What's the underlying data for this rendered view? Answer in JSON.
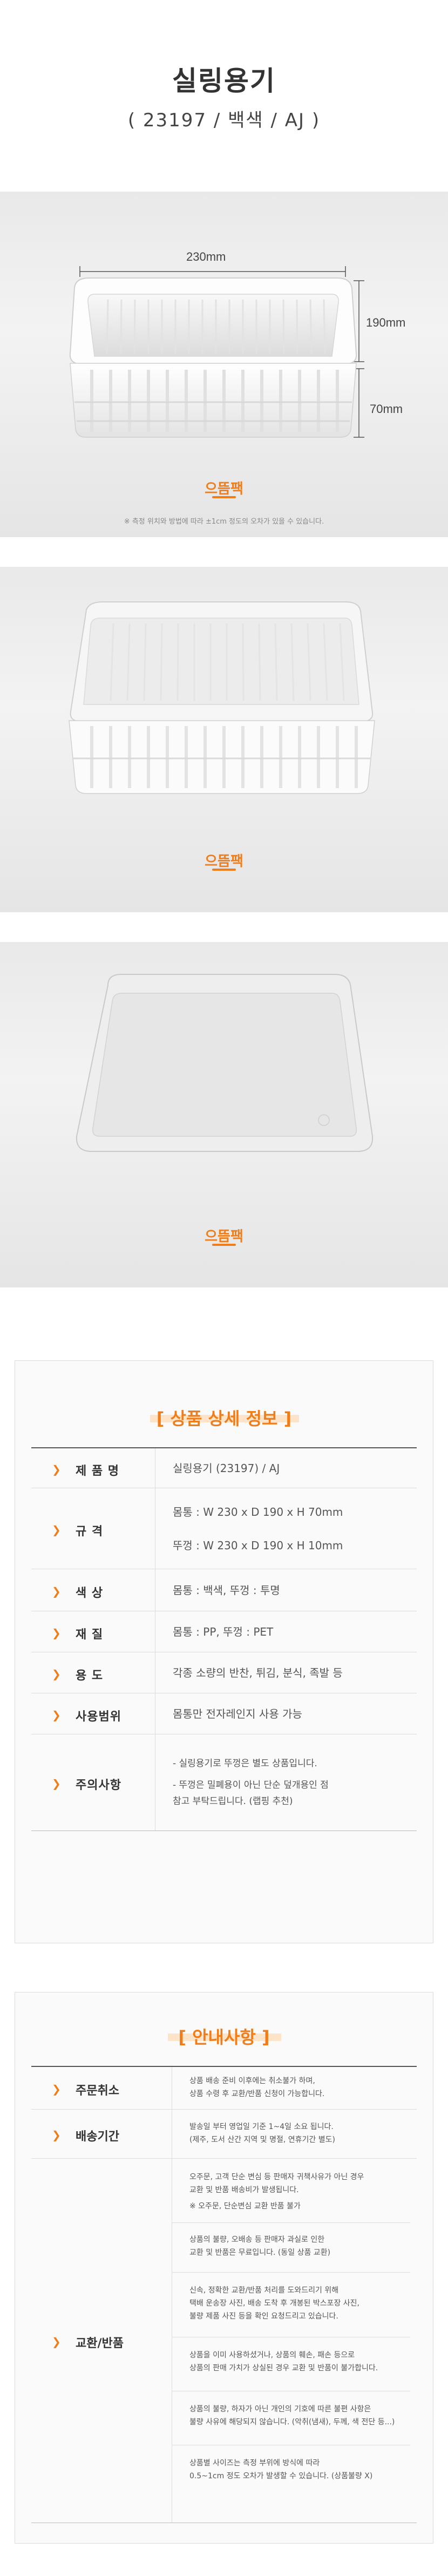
{
  "header": {
    "title": "실링용기",
    "subtitle": "( 23197 / 백색 / AJ )"
  },
  "photo1": {
    "dim_width": "230mm",
    "dim_depth": "190mm",
    "dim_height": "70mm",
    "note": "※ 측정 위치와 방법에 따라 ±1cm 정도의 오차가 있을 수 있습니다.",
    "logo": "으뜸팩"
  },
  "photo2": {
    "logo": "으뜸팩"
  },
  "photo3": {
    "logo": "으뜸팩"
  },
  "spec": {
    "title": "[ 상품 상세 정보 ]",
    "rows": [
      {
        "label": "제 품 명",
        "lines": [
          "실링용기 (23197) / AJ"
        ]
      },
      {
        "label": "규    격",
        "lines": [
          "몸통 : W 230 x D 190 x H 70mm",
          "뚜껑 : W 230 x D 190 x H 10mm"
        ]
      },
      {
        "label": "색    상",
        "lines": [
          "몸통 : 백색,  뚜껑 : 투명"
        ]
      },
      {
        "label": "재    질",
        "lines": [
          "몸통 : PP,  뚜껑 : PET"
        ]
      },
      {
        "label": "용    도",
        "lines": [
          "각종 소량의 반찬, 튀김, 분식, 족발 등"
        ]
      },
      {
        "label": "사용범위",
        "lines": [
          "몸통만 전자레인지 사용 가능"
        ]
      },
      {
        "label": "주의사항",
        "lines": [
          "- 실링용기로 뚜껑은 별도 상품입니다.",
          "- 뚜껑은 밀폐용이 아닌 단순 덮개용인 점",
          "   참고 부탁드립니다. (랩핑 추천)"
        ]
      }
    ]
  },
  "info": {
    "title": "[ 안내사항 ]",
    "cancel": {
      "label": "주문취소",
      "lines": [
        "상품 배송 준비 이후에는 취소불가 하며,",
        "상품 수령 후 교환/반품 신청이 가능합니다."
      ]
    },
    "delivery": {
      "label": "배송기간",
      "lines": [
        "발송일 부터 영업일 기준 1~4일 소요 됩니다.",
        "(제주, 도서 산간 지역 및 명절, 연휴기간 별도)"
      ]
    },
    "exchange": {
      "label": "교환/반품",
      "blocks": [
        [
          "오주문, 고객 단순 변심 등 판매자 귀책사유가 아닌 경우",
          "교환 및 반품 배송비가 발생됩니다.",
          "※ 오주문, 단순변심 교환 반품 불가"
        ],
        [
          "상품의 불량, 오배송 등 판매자 과실로 인한",
          "교환 및 반품은 무료입니다. (동일 상품 교환)"
        ],
        [
          "신속, 정확한 교환/반품 처리를 도와드리기 위해",
          "택배 운송장 사진, 배송 도착 후 개봉된 박스포장 사진,",
          "불량 제품 사진 등을 확인 요청드리고 있습니다."
        ],
        [
          "상품을 이미 사용하셨거나, 상품의 훼손, 패손 등으로",
          "상품의 판매 가치가 상실된 경우 교환 및 반품이 불가합니다."
        ],
        [
          "상품의 불량, 하자가 아닌 개인의 기호에 따른 불편 사항은",
          "불량 사유에 해당되지 않습니다. (악취(냄새), 두께, 색 전단 등...)"
        ],
        [
          "상품별 사이즈는 측정 부위에 방식에 따라",
          "0.5~1cm 정도 오차가 발생할 수 있습니다. (상품불량 X)"
        ]
      ]
    }
  }
}
